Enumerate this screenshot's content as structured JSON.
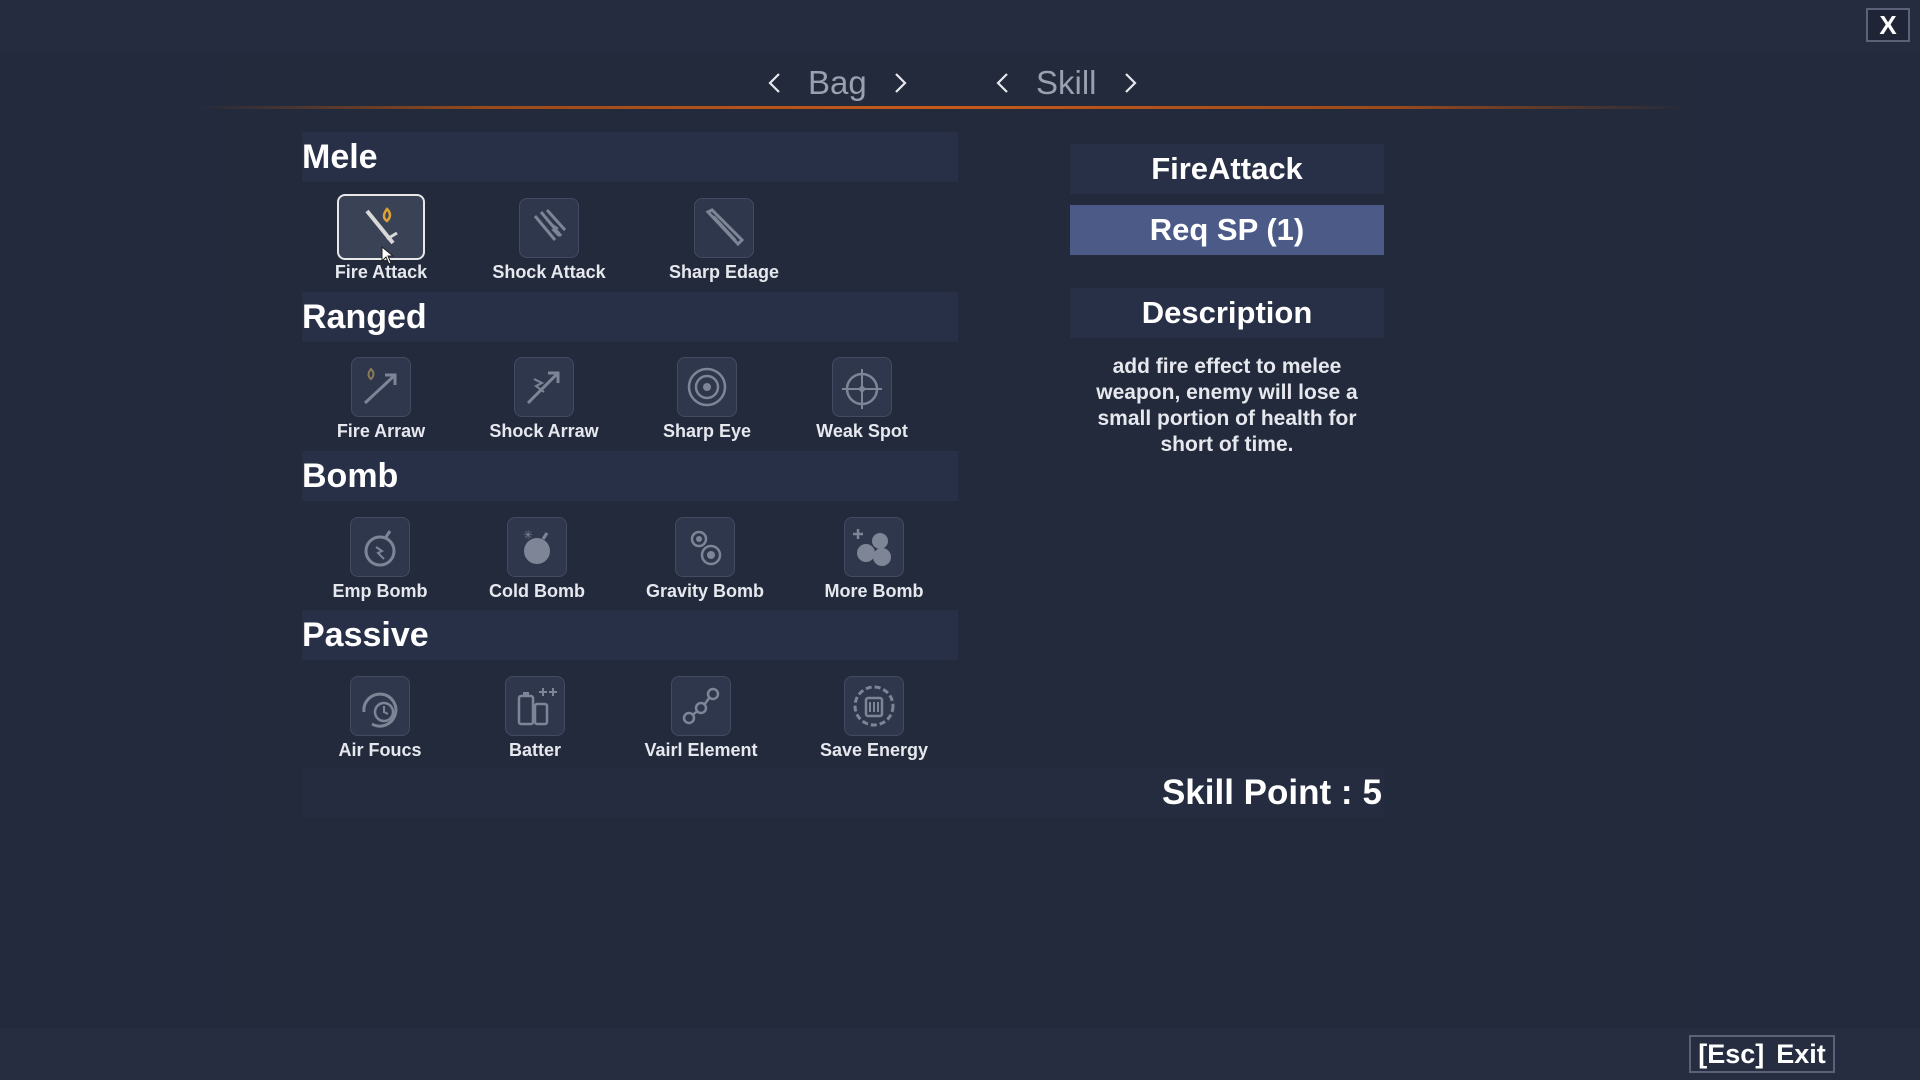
{
  "window": {
    "close_label": "X"
  },
  "nav": {
    "bag_label": "Bag",
    "skill_label": "Skill"
  },
  "categories": [
    {
      "label": "Mele",
      "skills": [
        "Fire Attack",
        "Shock Attack",
        "Sharp Edage"
      ]
    },
    {
      "label": "Ranged",
      "skills": [
        "Fire Arraw",
        "Shock Arraw",
        "Sharp Eye",
        "Weak Spot"
      ]
    },
    {
      "label": "Bomb",
      "skills": [
        "Emp Bomb",
        "Cold Bomb",
        "Gravity Bomb",
        "More Bomb"
      ]
    },
    {
      "label": "Passive",
      "skills": [
        "Air Foucs",
        "Batter",
        "Vairl Element",
        "Save Energy"
      ]
    }
  ],
  "icons": {
    "fire_attack": "sword-fire-icon",
    "shock_attack": "claw-lightning-icon",
    "sharp_edage": "blade-icon",
    "fire_arraw": "arrow-fire-icon",
    "shock_arraw": "arrow-lightning-icon",
    "sharp_eye": "eye-target-icon",
    "weak_spot": "crosshair-icon",
    "emp_bomb": "emp-bomb-icon",
    "cold_bomb": "cold-bomb-icon",
    "gravity_bomb": "gravity-bomb-icon",
    "more_bomb": "multi-bomb-icon",
    "air_foucs": "clock-focus-icon",
    "batter": "battery-icon",
    "vairl_element": "element-chain-icon",
    "save_energy": "energy-saver-icon"
  },
  "detail": {
    "title": "FireAttack",
    "req_sp": "Req SP (1)",
    "description_header": "Description",
    "description": "add fire effect to melee weapon, enemy will lose a small portion of health for short of time."
  },
  "skill_point": {
    "label": "Skill Point :",
    "value": "5"
  },
  "footer": {
    "esc_key": "[Esc]",
    "exit_label": "Exit"
  },
  "colors": {
    "background": "#232a3d",
    "category_bar": "#283048",
    "req_button": "#4c5a88",
    "accent_line": "#c75a1b",
    "fire_accent": "#e0a235"
  },
  "selected_skill": "Fire Attack"
}
